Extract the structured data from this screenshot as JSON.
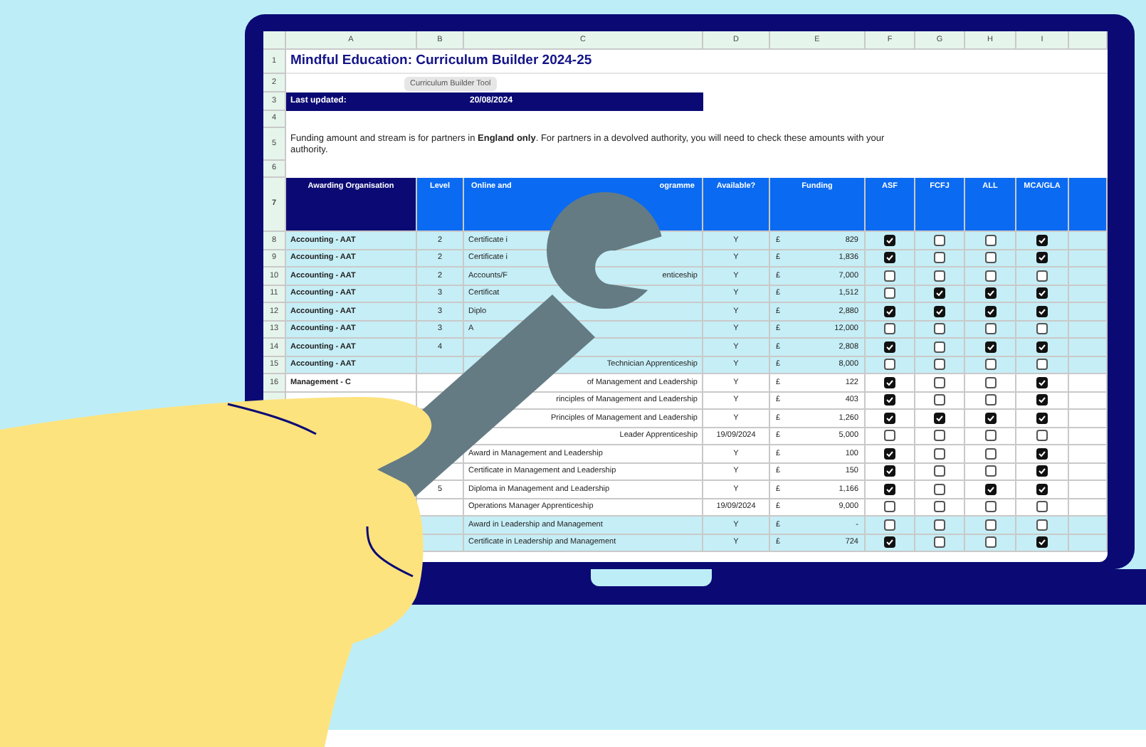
{
  "spreadsheet": {
    "column_headers": [
      "A",
      "B",
      "C",
      "D",
      "E",
      "F",
      "G",
      "H",
      "I"
    ],
    "title": "Mindful Education: Curriculum Builder 2024-25",
    "tooltip": "Curriculum Builder Tool",
    "last_updated": {
      "label": "Last updated:",
      "value": "20/08/2024"
    },
    "note": "Funding amount and stream is for partners in **England only**. For partners in a devolved authority, you will need to check these amounts with your authority.",
    "top_row_numbers": [
      "1",
      "2",
      "3",
      "4",
      "5",
      "6",
      "7"
    ],
    "table_headers": {
      "organisation": "Awarding Organisation",
      "level": "Level",
      "programme": "Online and",
      "programme_tail": "ogramme",
      "available": "Available?",
      "funding": "Funding",
      "streams": [
        "ASF",
        "FCFJ",
        "ALL",
        "MCA/GLA"
      ]
    },
    "rows": [
      {
        "num": "8",
        "highlighted": true,
        "org": "Accounting - AAT",
        "level": "2",
        "programme": "Certificate i",
        "available": "Y",
        "currency": "£",
        "funding": "829",
        "checks": [
          true,
          false,
          false,
          true
        ]
      },
      {
        "num": "9",
        "highlighted": true,
        "org": "Accounting - AAT",
        "level": "2",
        "programme": "Certificate i",
        "available": "Y",
        "currency": "£",
        "funding": "1,836",
        "checks": [
          true,
          false,
          false,
          true
        ]
      },
      {
        "num": "10",
        "highlighted": true,
        "org": "Accounting - AAT",
        "level": "2",
        "programme": "Accounts/F",
        "programme_tail": "enticeship",
        "available": "Y",
        "currency": "£",
        "funding": "7,000",
        "checks": [
          false,
          false,
          false,
          false
        ]
      },
      {
        "num": "11",
        "highlighted": true,
        "org": "Accounting - AAT",
        "level": "3",
        "programme": "Certificat",
        "available": "Y",
        "currency": "£",
        "funding": "1,512",
        "checks": [
          false,
          true,
          true,
          true
        ]
      },
      {
        "num": "12",
        "highlighted": true,
        "org": "Accounting - AAT",
        "level": "3",
        "programme": "Diplo",
        "available": "Y",
        "currency": "£",
        "funding": "2,880",
        "checks": [
          true,
          true,
          true,
          true
        ]
      },
      {
        "num": "13",
        "highlighted": true,
        "org": "Accounting - AAT",
        "level": "3",
        "programme": "A",
        "available": "Y",
        "currency": "£",
        "funding": "12,000",
        "checks": [
          false,
          false,
          false,
          false
        ]
      },
      {
        "num": "14",
        "highlighted": true,
        "org": "Accounting - AAT",
        "level": "4",
        "available": "Y",
        "currency": "£",
        "funding": "2,808",
        "checks": [
          true,
          false,
          true,
          true
        ]
      },
      {
        "num": "15",
        "highlighted": true,
        "org": "Accounting - AAT",
        "programme_tail": "Technician Apprenticeship",
        "available": "Y",
        "currency": "£",
        "funding": "8,000",
        "checks": [
          false,
          false,
          false,
          false
        ]
      },
      {
        "num": "16",
        "highlighted": false,
        "org": "Management - C",
        "programme_tail": "of Management and Leadership",
        "available": "Y",
        "currency": "£",
        "funding": "122",
        "checks": [
          true,
          false,
          false,
          true
        ]
      },
      {
        "highlighted": false,
        "programme_tail": "rinciples of Management and Leadership",
        "available": "Y",
        "currency": "£",
        "funding": "403",
        "checks": [
          true,
          false,
          false,
          true
        ]
      },
      {
        "highlighted": false,
        "programme_tail": "Principles of Management and Leadership",
        "available": "Y",
        "currency": "£",
        "funding": "1,260",
        "checks": [
          true,
          true,
          true,
          true
        ]
      },
      {
        "highlighted": false,
        "programme_tail": "Leader Apprenticeship",
        "available": "19/09/2024",
        "currency": "£",
        "funding": "5,000",
        "checks": [
          false,
          false,
          false,
          false
        ]
      },
      {
        "highlighted": false,
        "programme": "Award in Management and Leadership",
        "available": "Y",
        "currency": "£",
        "funding": "100",
        "checks": [
          true,
          false,
          false,
          true
        ]
      },
      {
        "highlighted": false,
        "programme": "Certificate in Management and Leadership",
        "available": "Y",
        "currency": "£",
        "funding": "150",
        "checks": [
          true,
          false,
          false,
          true
        ]
      },
      {
        "highlighted": false,
        "level": "5",
        "programme": "Diploma in Management and Leadership",
        "available": "Y",
        "currency": "£",
        "funding": "1,166",
        "checks": [
          true,
          false,
          true,
          true
        ]
      },
      {
        "highlighted": false,
        "programme": "Operations Manager Apprenticeship",
        "available": "19/09/2024",
        "currency": "£",
        "funding": "9,000",
        "checks": [
          false,
          false,
          false,
          false
        ]
      },
      {
        "highlighted": true,
        "programme": "Award in Leadership and Management",
        "available": "Y",
        "currency": "£",
        "funding": "-",
        "checks": [
          false,
          false,
          false,
          false
        ]
      },
      {
        "highlighted": true,
        "programme": "Certificate in Leadership and Management",
        "available": "Y",
        "currency": "£",
        "funding": "724",
        "checks": [
          true,
          false,
          false,
          true
        ]
      }
    ]
  }
}
